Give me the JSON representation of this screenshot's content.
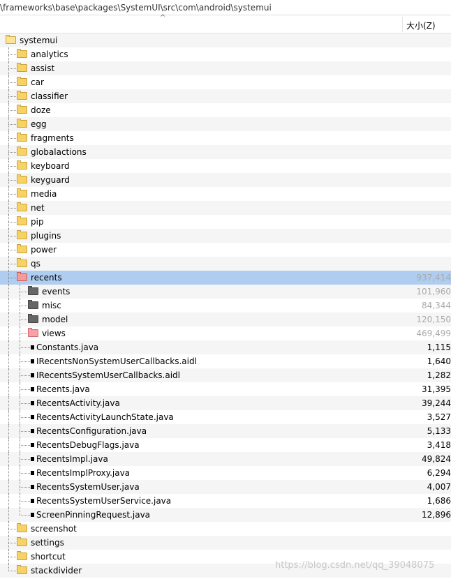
{
  "path": "\\frameworks\\base\\packages\\SystemUI\\src\\com\\android\\systemui",
  "header": {
    "size_label": "大小(Z)",
    "sort_caret": "^"
  },
  "tree": [
    {
      "name": "systemui",
      "type": "folder",
      "level": 0,
      "size": ""
    },
    {
      "name": "analytics",
      "type": "folder",
      "level": 1,
      "size": ""
    },
    {
      "name": "assist",
      "type": "folder",
      "level": 1,
      "size": ""
    },
    {
      "name": "car",
      "type": "folder",
      "level": 1,
      "size": ""
    },
    {
      "name": "classifier",
      "type": "folder",
      "level": 1,
      "size": ""
    },
    {
      "name": "doze",
      "type": "folder",
      "level": 1,
      "size": ""
    },
    {
      "name": "egg",
      "type": "folder",
      "level": 1,
      "size": ""
    },
    {
      "name": "fragments",
      "type": "folder",
      "level": 1,
      "size": ""
    },
    {
      "name": "globalactions",
      "type": "folder",
      "level": 1,
      "size": ""
    },
    {
      "name": "keyboard",
      "type": "folder",
      "level": 1,
      "size": ""
    },
    {
      "name": "keyguard",
      "type": "folder",
      "level": 1,
      "size": ""
    },
    {
      "name": "media",
      "type": "folder",
      "level": 1,
      "size": ""
    },
    {
      "name": "net",
      "type": "folder",
      "level": 1,
      "size": ""
    },
    {
      "name": "pip",
      "type": "folder",
      "level": 1,
      "size": ""
    },
    {
      "name": "plugins",
      "type": "folder",
      "level": 1,
      "size": ""
    },
    {
      "name": "power",
      "type": "folder",
      "level": 1,
      "size": ""
    },
    {
      "name": "qs",
      "type": "folder",
      "level": 1,
      "size": ""
    },
    {
      "name": "recents",
      "type": "folder",
      "level": 1,
      "size": "937,414",
      "selected": true,
      "icon": "red"
    },
    {
      "name": "events",
      "type": "folder",
      "level": 2,
      "size": "101,960",
      "icon": "gray"
    },
    {
      "name": "misc",
      "type": "folder",
      "level": 2,
      "size": "84,344",
      "icon": "gray"
    },
    {
      "name": "model",
      "type": "folder",
      "level": 2,
      "size": "120,150",
      "icon": "gray"
    },
    {
      "name": "views",
      "type": "folder",
      "level": 2,
      "size": "469,499",
      "icon": "pink"
    },
    {
      "name": "Constants.java",
      "type": "file",
      "level": 2,
      "size": "1,115"
    },
    {
      "name": "IRecentsNonSystemUserCallbacks.aidl",
      "type": "file",
      "level": 2,
      "size": "1,640"
    },
    {
      "name": "IRecentsSystemUserCallbacks.aidl",
      "type": "file",
      "level": 2,
      "size": "1,282"
    },
    {
      "name": "Recents.java",
      "type": "file",
      "level": 2,
      "size": "31,395"
    },
    {
      "name": "RecentsActivity.java",
      "type": "file",
      "level": 2,
      "size": "39,244"
    },
    {
      "name": "RecentsActivityLaunchState.java",
      "type": "file",
      "level": 2,
      "size": "3,527"
    },
    {
      "name": "RecentsConfiguration.java",
      "type": "file",
      "level": 2,
      "size": "5,133"
    },
    {
      "name": "RecentsDebugFlags.java",
      "type": "file",
      "level": 2,
      "size": "3,418"
    },
    {
      "name": "RecentsImpl.java",
      "type": "file",
      "level": 2,
      "size": "49,824"
    },
    {
      "name": "RecentsImplProxy.java",
      "type": "file",
      "level": 2,
      "size": "6,294"
    },
    {
      "name": "RecentsSystemUser.java",
      "type": "file",
      "level": 2,
      "size": "4,007"
    },
    {
      "name": "RecentsSystemUserService.java",
      "type": "file",
      "level": 2,
      "size": "1,686"
    },
    {
      "name": "ScreenPinningRequest.java",
      "type": "file",
      "level": 2,
      "size": "12,896"
    },
    {
      "name": "screenshot",
      "type": "folder",
      "level": 1,
      "size": ""
    },
    {
      "name": "settings",
      "type": "folder",
      "level": 1,
      "size": ""
    },
    {
      "name": "shortcut",
      "type": "folder",
      "level": 1,
      "size": ""
    },
    {
      "name": "stackdivider",
      "type": "folder",
      "level": 1,
      "size": ""
    }
  ],
  "watermark": "https://blog.csdn.net/qq_39048075"
}
